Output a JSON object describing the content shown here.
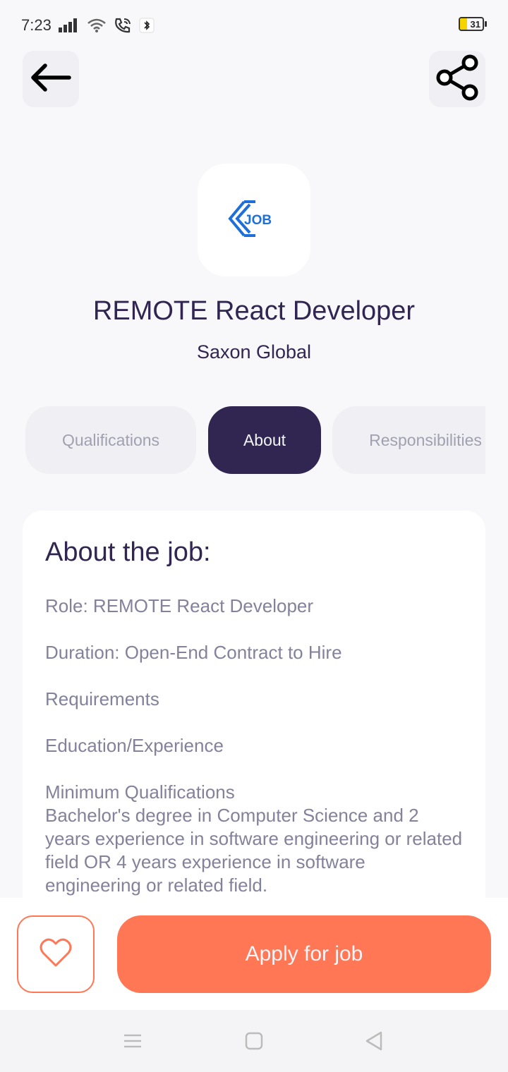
{
  "status_bar": {
    "time": "7:23",
    "battery_level": "31",
    "icons": [
      "signal-icon",
      "wifi-icon",
      "wifi-calling-icon",
      "bluetooth-notification-icon"
    ]
  },
  "header": {
    "back_icon": "arrow-left-icon",
    "share_icon": "share-icon"
  },
  "job": {
    "logo_text": "JOB",
    "title": "REMOTE React Developer",
    "company": "Saxon Global"
  },
  "tabs": [
    {
      "label": "Qualifications",
      "active": false
    },
    {
      "label": "About",
      "active": true
    },
    {
      "label": "Responsibilities",
      "active": false
    }
  ],
  "about": {
    "heading": "About the job:",
    "paragraphs": [
      "Role: REMOTE React Developer",
      "Duration: Open-End Contract to Hire",
      "Requirements",
      "Education/Experience",
      "Minimum Qualifications\nBachelor's degree in Computer Science and 2 years experience in software engineering or related field OR 4 years experience in software engineering or related field."
    ]
  },
  "footer": {
    "favorite_icon": "heart-icon",
    "apply_label": "Apply for job"
  },
  "colors": {
    "primary": "#312651",
    "accent": "#ff7754",
    "muted_text": "#83829a",
    "background": "#f8f8fb"
  }
}
